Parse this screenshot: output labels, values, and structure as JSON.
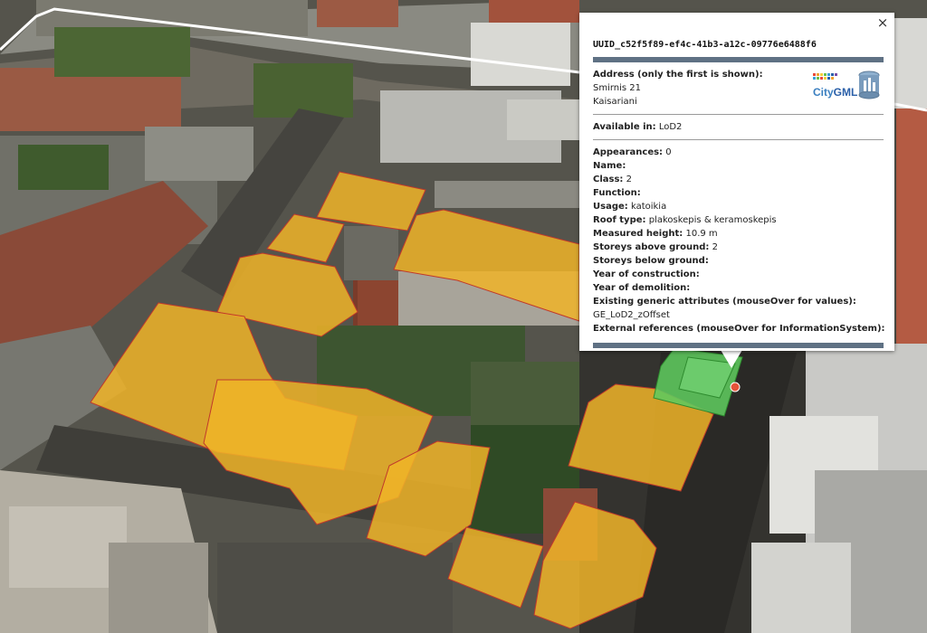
{
  "colors": {
    "building_fill": "#f0b428",
    "building_edge": "#c0392b",
    "selected_fill": "#5ec95e",
    "panel_bar": "#5f7184"
  },
  "balloon": {
    "close_label": "×",
    "title": "UUID_c52f5f89-ef4c-41b3-a12c-09776e6488f6",
    "address_label": "Address (only the first is shown):",
    "address_street": "Smirnis 21",
    "address_city": "Kaisariani",
    "logo_text_a": "City",
    "logo_text_b": "GML",
    "available_label": "Available in:",
    "available_value": "LoD2",
    "appearances_label": "Appearances:",
    "appearances_value": "0",
    "name_label": "Name:",
    "name_value": "",
    "class_label": "Class:",
    "class_value": "2",
    "function_label": "Function:",
    "function_value": "",
    "usage_label": "Usage:",
    "usage_value": "katoikia",
    "roof_label": "Roof type:",
    "roof_value": "plakoskepis & keramoskepis",
    "height_label": "Measured height:",
    "height_value": "10.9 m",
    "storeys_above_label": "Storeys above ground:",
    "storeys_above_value": "2",
    "storeys_below_label": "Storeys below ground:",
    "storeys_below_value": "",
    "construction_label": "Year of construction:",
    "construction_value": "",
    "demolition_label": "Year of demolition:",
    "demolition_value": "",
    "generic_label": "Existing generic attributes (mouseOver for values):",
    "generic_value": "GE_LoD2_zOffset",
    "external_label": "External references (mouseOver for InformationSystem):"
  }
}
